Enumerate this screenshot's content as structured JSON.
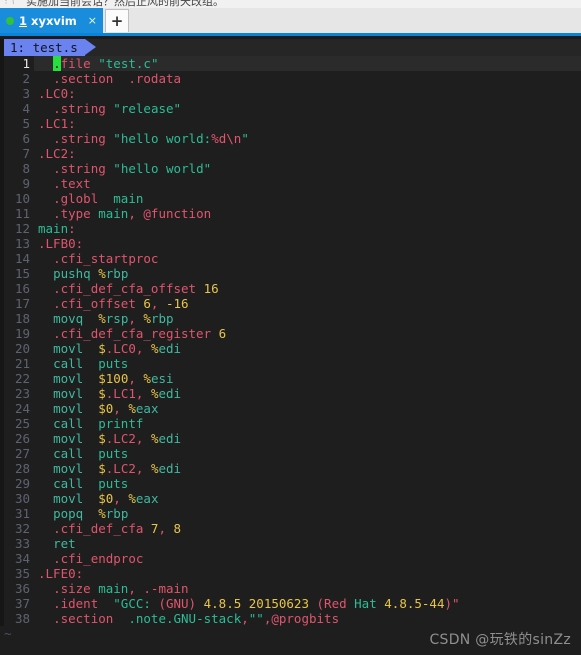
{
  "top_strip": {
    "truncated_text": "实施加当前会话？然后正风的前天改组。",
    "dots": "⋮"
  },
  "app_tabbar": {
    "tab": {
      "number": "1",
      "title": "xyxvim",
      "close_label": "×",
      "status_dot_color": "#31c13a",
      "active_color": "#1a8cdc"
    },
    "new_tab_label": "+"
  },
  "vim_tabline": {
    "active_tab_label": "1: test.s",
    "tab_bg_color": "#6a83f0"
  },
  "editor": {
    "filename": "test.s",
    "cursor_line": 1,
    "cursor_color": "#26e03d",
    "empty_marker": "~",
    "total_lines": 38,
    "lines": [
      {
        "n": "1",
        "text": "  .file \"test.c\""
      },
      {
        "n": "2",
        "text": "  .section  .rodata"
      },
      {
        "n": "3",
        "text": ".LC0:"
      },
      {
        "n": "4",
        "text": "  .string \"release\""
      },
      {
        "n": "5",
        "text": ".LC1:"
      },
      {
        "n": "6",
        "text": "  .string \"hello world:%d\\n\""
      },
      {
        "n": "7",
        "text": ".LC2:"
      },
      {
        "n": "8",
        "text": "  .string \"hello world\""
      },
      {
        "n": "9",
        "text": "  .text"
      },
      {
        "n": "10",
        "text": "  .globl  main"
      },
      {
        "n": "11",
        "text": "  .type main, @function"
      },
      {
        "n": "12",
        "text": "main:"
      },
      {
        "n": "13",
        "text": ".LFB0:"
      },
      {
        "n": "14",
        "text": "  .cfi_startproc"
      },
      {
        "n": "15",
        "text": "  pushq %rbp"
      },
      {
        "n": "16",
        "text": "  .cfi_def_cfa_offset 16"
      },
      {
        "n": "17",
        "text": "  .cfi_offset 6, -16"
      },
      {
        "n": "18",
        "text": "  movq  %rsp, %rbp"
      },
      {
        "n": "19",
        "text": "  .cfi_def_cfa_register 6"
      },
      {
        "n": "20",
        "text": "  movl  $.LC0, %edi"
      },
      {
        "n": "21",
        "text": "  call  puts"
      },
      {
        "n": "22",
        "text": "  movl  $100, %esi"
      },
      {
        "n": "23",
        "text": "  movl  $.LC1, %edi"
      },
      {
        "n": "24",
        "text": "  movl  $0, %eax"
      },
      {
        "n": "25",
        "text": "  call  printf"
      },
      {
        "n": "26",
        "text": "  movl  $.LC2, %edi"
      },
      {
        "n": "27",
        "text": "  call  puts"
      },
      {
        "n": "28",
        "text": "  movl  $.LC2, %edi"
      },
      {
        "n": "29",
        "text": "  call  puts"
      },
      {
        "n": "30",
        "text": "  movl  $0, %eax"
      },
      {
        "n": "31",
        "text": "  popq  %rbp"
      },
      {
        "n": "32",
        "text": "  .cfi_def_cfa 7, 8"
      },
      {
        "n": "33",
        "text": "  ret"
      },
      {
        "n": "34",
        "text": "  .cfi_endproc"
      },
      {
        "n": "35",
        "text": ".LFE0:"
      },
      {
        "n": "36",
        "text": "  .size main, .-main"
      },
      {
        "n": "37",
        "text": "  .ident  \"GCC: (GNU) 4.8.5 20150623 (Red Hat 4.8.5-44)\""
      },
      {
        "n": "38",
        "text": "  .section  .note.GNU-stack,\"\",@progbits"
      }
    ]
  },
  "watermark": {
    "text": "CSDN @玩铁的sinZz"
  },
  "colors": {
    "background": "#1e1e1e",
    "directive": "#e0556d",
    "string": "#2bbd95",
    "instruction": "#3fb9a0",
    "number": "#e8c547",
    "linenumber": "#5c6370",
    "accent_blue": "#1a8cdc"
  }
}
